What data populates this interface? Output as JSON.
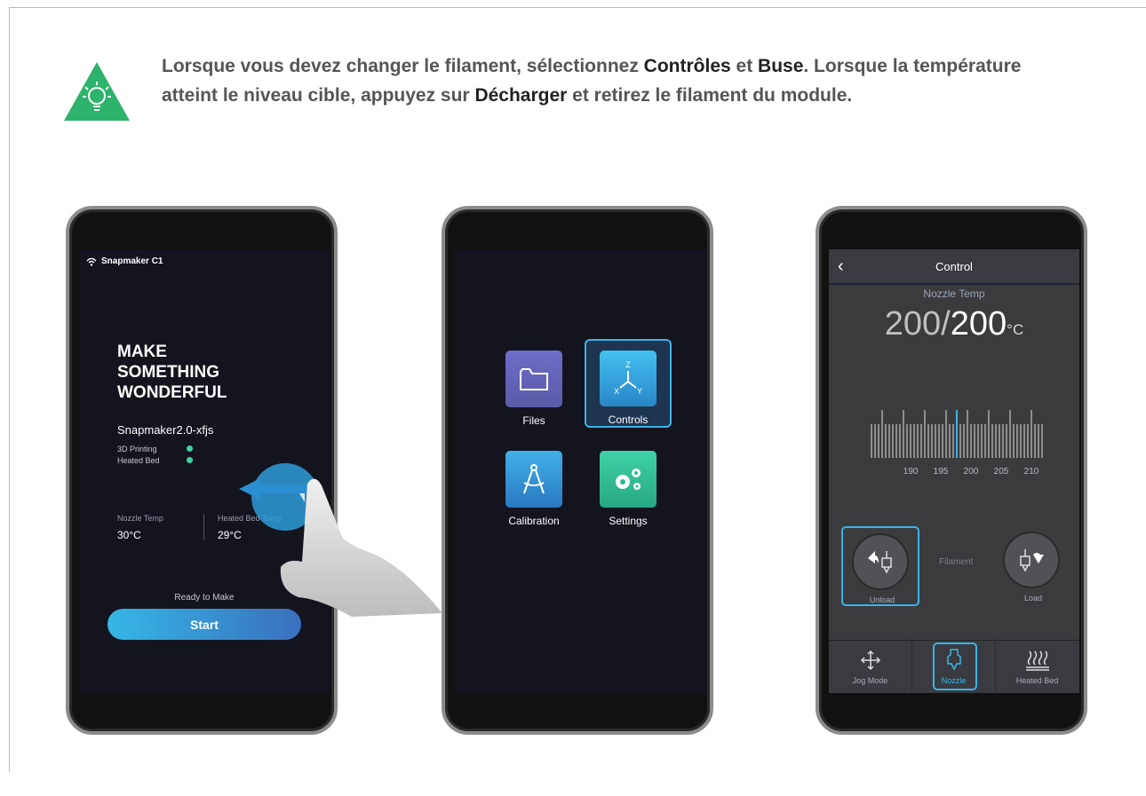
{
  "tip": {
    "line1_a": "Lorsque vous devez changer le filament, sélectionnez ",
    "line1_b": "Contrôles",
    "line1_c": " et ",
    "line1_d": "Buse",
    "line1_e": ". Lorsque la température atteint le niveau cible, appuyez sur ",
    "line1_f": "Décharger",
    "line1_g": " et retirez le filament du module.",
    "icon": "lightbulb-icon",
    "icon_color": "#2db36b"
  },
  "phone1": {
    "status": "Snapmaker C1",
    "hero": [
      "MAKE",
      "SOMETHING",
      "WONDERFUL"
    ],
    "device": "Snapmaker2.0-xfjs",
    "status_rows": [
      "3D Printing",
      "Heated Bed"
    ],
    "nozzle_label": "Nozzle Temp",
    "nozzle_value": "30°C",
    "bed_label": "Heated Bed Temp",
    "bed_value": "29°C",
    "ready": "Ready to Make",
    "start": "Start",
    "dot_color": "#3ed2a0"
  },
  "phone2": {
    "tiles": [
      {
        "label": "Files",
        "icon": "folder-icon"
      },
      {
        "label": "Controls",
        "icon": "axes-icon"
      },
      {
        "label": "Calibration",
        "icon": "compass-icon"
      },
      {
        "label": "Settings",
        "icon": "gears-icon"
      }
    ],
    "axes": {
      "z": "Z",
      "x": "X",
      "y": "Y"
    }
  },
  "phone3": {
    "title": "Control",
    "temp_label": "Nozzle Temp",
    "temp_current": "200",
    "temp_target": "200",
    "temp_unit": "°C",
    "ruler_ticks": [
      "190",
      "195",
      "200",
      "205",
      "210"
    ],
    "filament_label": "Filament",
    "unload": "Unload",
    "load": "Load",
    "tabs": [
      {
        "label": "Jog Mode",
        "icon": "move-arrows-icon"
      },
      {
        "label": "Nozzle",
        "icon": "nozzle-icon"
      },
      {
        "label": "Heated Bed",
        "icon": "heated-bed-icon"
      }
    ],
    "accent": "#3ab4e8"
  }
}
